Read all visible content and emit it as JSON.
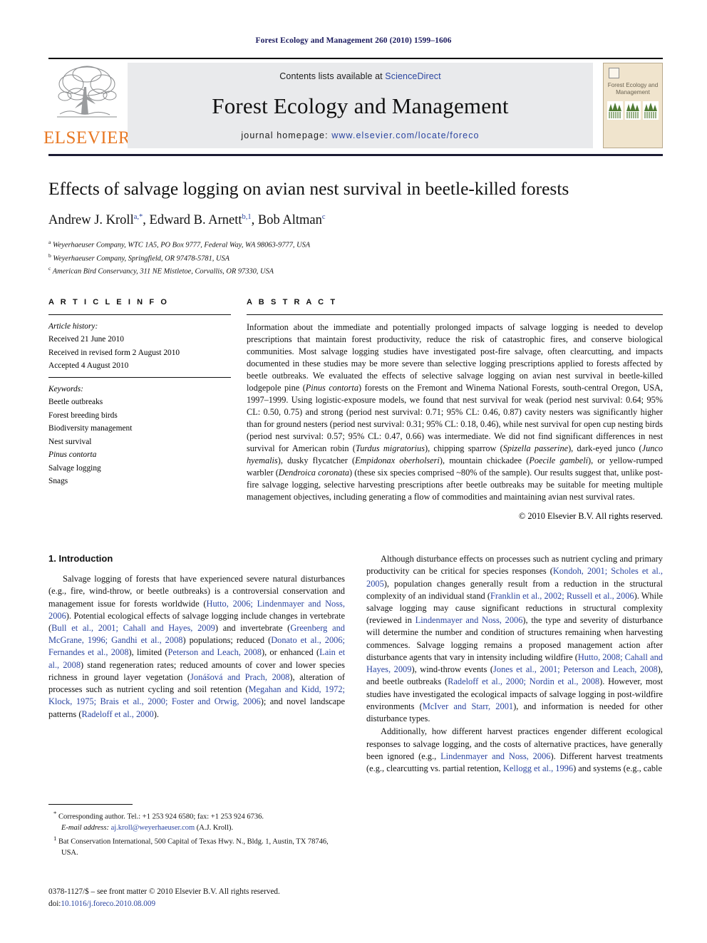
{
  "running_head": "Forest Ecology and Management 260 (2010) 1599–1606",
  "masthead": {
    "publisher": "ELSEVIER",
    "contents_prefix": "Contents lists available at",
    "contents_link": "ScienceDirect",
    "journal_name": "Forest Ecology and Management",
    "homepage_prefix": "journal homepage:",
    "homepage_url": "www.elsevier.com/locate/foreco",
    "cover_title": "Forest Ecology and Management"
  },
  "article": {
    "title": "Effects of salvage logging on avian nest survival in beetle-killed forests",
    "authors": [
      {
        "name": "Andrew J. Kroll",
        "marks": "a,*"
      },
      {
        "name": "Edward B. Arnett",
        "marks": "b,1"
      },
      {
        "name": "Bob Altman",
        "marks": "c"
      }
    ],
    "affiliations": [
      {
        "mark": "a",
        "text": "Weyerhaeuser Company, WTC 1A5, PO Box 9777, Federal Way, WA 98063-9777, USA"
      },
      {
        "mark": "b",
        "text": "Weyerhaeuser Company, Springfield, OR 97478-5781, USA"
      },
      {
        "mark": "c",
        "text": "American Bird Conservancy, 311 NE Mistletoe, Corvallis, OR 97330, USA"
      }
    ]
  },
  "article_info": {
    "heading": "A R T I C L E   I N F O",
    "history_label": "Article history:",
    "history": [
      "Received 21 June 2010",
      "Received in revised form 2 August 2010",
      "Accepted 4 August 2010"
    ],
    "keywords_label": "Keywords:",
    "keywords": [
      "Beetle outbreaks",
      "Forest breeding birds",
      "Biodiversity management",
      "Nest survival",
      "Pinus contorta",
      "Salvage logging",
      "Snags"
    ],
    "keywords_italic_index": 4
  },
  "abstract": {
    "heading": "A B S T R A C T",
    "text_parts": [
      {
        "t": "Information about the immediate and potentially prolonged impacts of salvage logging is needed to develop prescriptions that maintain forest productivity, reduce the risk of catastrophic fires, and conserve biological communities. Most salvage logging studies have investigated post-fire salvage, often clearcutting, and impacts documented in these studies may be more severe than selective logging prescriptions applied to forests affected by beetle outbreaks. We evaluated the effects of selective salvage logging on avian nest survival in beetle-killed lodgepole pine ("
      },
      {
        "t": "Pinus contorta",
        "i": true
      },
      {
        "t": ") forests on the Fremont and Winema National Forests, south-central Oregon, USA, 1997–1999. Using logistic-exposure models, we found that nest survival for weak (period nest survival: 0.64; 95% CL: 0.50, 0.75) and strong (period nest survival: 0.71; 95% CL: 0.46, 0.87) cavity nesters was significantly higher than for ground nesters (period nest survival: 0.31; 95% CL: 0.18, 0.46), while nest survival for open cup nesting birds (period nest survival: 0.57; 95% CL: 0.47, 0.66) was intermediate. We did not find significant differences in nest survival for American robin ("
      },
      {
        "t": "Turdus migratorius",
        "i": true
      },
      {
        "t": "), chipping sparrow ("
      },
      {
        "t": "Spizella passerine",
        "i": true
      },
      {
        "t": "), dark-eyed junco ("
      },
      {
        "t": "Junco hyemalis",
        "i": true
      },
      {
        "t": "), dusky flycatcher ("
      },
      {
        "t": "Empidonax oberholseri",
        "i": true
      },
      {
        "t": "), mountain chickadee ("
      },
      {
        "t": "Poecile gambeli",
        "i": true
      },
      {
        "t": "), or yellow-rumped warbler ("
      },
      {
        "t": "Dendroica coronata",
        "i": true
      },
      {
        "t": ") (these six species comprised ~80% of the sample). Our results suggest that, unlike post-fire salvage logging, selective harvesting prescriptions after beetle outbreaks may be suitable for meeting multiple management objectives, including generating a flow of commodities and maintaining avian nest survival rates."
      }
    ],
    "copyright": "© 2010 Elsevier B.V. All rights reserved."
  },
  "introduction": {
    "section_number_title": "1.  Introduction",
    "left_paragraph_parts": [
      {
        "t": "Salvage logging of forests that have experienced severe natural disturbances (e.g., fire, wind-throw, or beetle outbreaks) is a controversial conservation and management issue for forests worldwide ("
      },
      {
        "t": "Hutto, 2006; Lindenmayer and Noss, 2006",
        "c": true
      },
      {
        "t": "). Potential ecological effects of salvage logging include changes in vertebrate ("
      },
      {
        "t": "Bull et al., 2001; Cahall and Hayes, 2009",
        "c": true
      },
      {
        "t": ") and invertebrate ("
      },
      {
        "t": "Greenberg and McGrane, 1996; Gandhi et al., 2008",
        "c": true
      },
      {
        "t": ") populations; reduced ("
      },
      {
        "t": "Donato et al., 2006; Fernandes et al., 2008",
        "c": true
      },
      {
        "t": "), limited ("
      },
      {
        "t": "Peterson and Leach, 2008",
        "c": true
      },
      {
        "t": "), or enhanced ("
      },
      {
        "t": "Lain et al., 2008",
        "c": true
      },
      {
        "t": ") stand regeneration rates; reduced amounts of cover and lower species richness in ground layer vegetation ("
      },
      {
        "t": "Jonášová and Prach, 2008",
        "c": true
      },
      {
        "t": "), alteration of processes such as nutrient cycling and soil retention ("
      },
      {
        "t": "Megahan and Kidd, 1972; Klock, 1975; Brais et al., 2000; Foster and Orwig, 2006",
        "c": true
      },
      {
        "t": "); and novel landscape patterns ("
      },
      {
        "t": "Radeloff et al., 2000",
        "c": true
      },
      {
        "t": ")."
      }
    ],
    "right_paragraph1_parts": [
      {
        "t": "Although disturbance effects on processes such as nutrient cycling and primary productivity can be critical for species responses ("
      },
      {
        "t": "Kondoh, 2001; Scholes et al., 2005",
        "c": true
      },
      {
        "t": "), population changes generally result from a reduction in the structural complexity of an individual stand ("
      },
      {
        "t": "Franklin et al., 2002; Russell et al., 2006",
        "c": true
      },
      {
        "t": "). While salvage logging may cause significant reductions in structural complexity (reviewed in "
      },
      {
        "t": "Lindenmayer and Noss, 2006",
        "c": true
      },
      {
        "t": "), the type and severity of disturbance will determine the number and condition of structures remaining when harvesting commences. Salvage logging remains a proposed management action after disturbance agents that vary in intensity including wildfire ("
      },
      {
        "t": "Hutto, 2008; Cahall and Hayes, 2009",
        "c": true
      },
      {
        "t": "), wind-throw events ("
      },
      {
        "t": "Jones et al., 2001; Peterson and Leach, 2008",
        "c": true
      },
      {
        "t": "), and beetle outbreaks ("
      },
      {
        "t": "Radeloff et al., 2000; Nordin et al., 2008",
        "c": true
      },
      {
        "t": "). However, most studies have investigated the ecological impacts of salvage logging in post-wildfire environments ("
      },
      {
        "t": "McIver and Starr, 2001",
        "c": true
      },
      {
        "t": "), and information is needed for other disturbance types."
      }
    ],
    "right_paragraph2_parts": [
      {
        "t": "Additionally, how different harvest practices engender different ecological responses to salvage logging, and the costs of alternative practices, have generally been ignored (e.g., "
      },
      {
        "t": "Lindenmayer and Noss, 2006",
        "c": true
      },
      {
        "t": "). Different harvest treatments (e.g., clearcutting vs. partial retention, "
      },
      {
        "t": "Kellogg et al., 1996",
        "c": true
      },
      {
        "t": ") and systems (e.g., cable"
      }
    ]
  },
  "footnotes": {
    "corresponding_mark": "*",
    "corresponding_text": "Corresponding author. Tel.: +1 253 924 6580; fax: +1 253 924 6736.",
    "email_label": "E-mail address:",
    "email": "aj.kroll@weyerhaeuser.com",
    "email_suffix": "(A.J. Kroll).",
    "note1_mark": "1",
    "note1_text": "Bat Conservation International, 500 Capital of Texas Hwy. N., Bldg. 1, Austin, TX 78746, USA."
  },
  "imprint": {
    "front_matter": "0378-1127/$ – see front matter © 2010 Elsevier B.V. All rights reserved.",
    "doi_label": "doi:",
    "doi_value": "10.1016/j.foreco.2010.08.009"
  },
  "colors": {
    "link": "#2b45a0",
    "elsevier_orange": "#E87722",
    "banner_bg": "#e9eaec",
    "running_head": "#1a1a5e"
  }
}
